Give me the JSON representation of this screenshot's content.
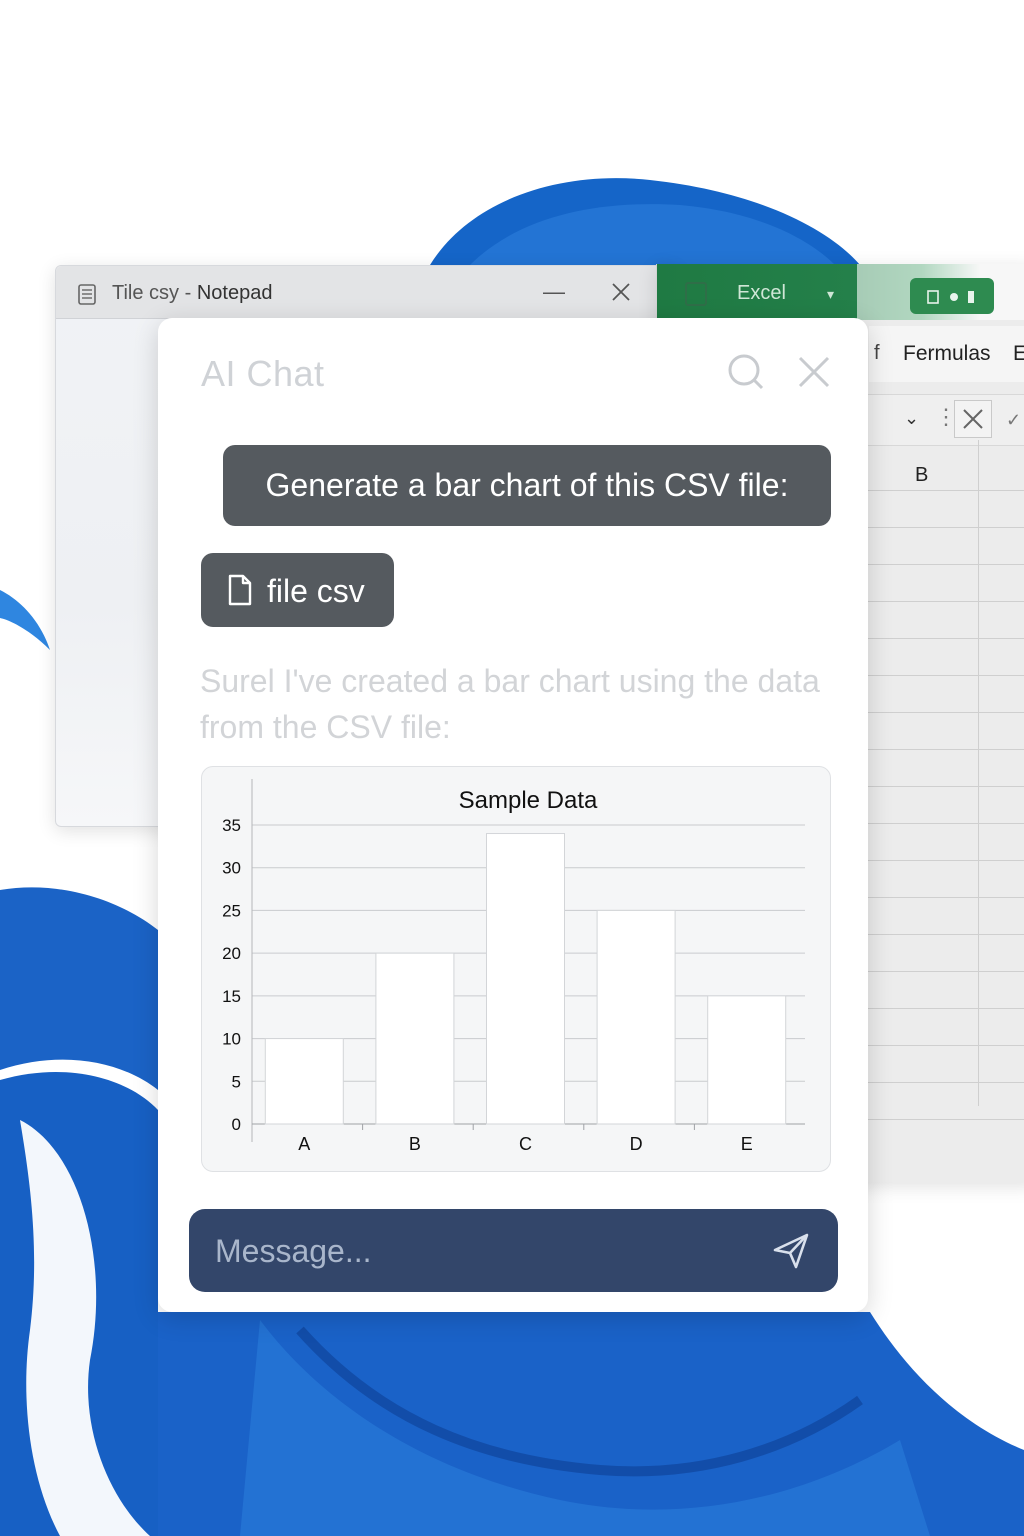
{
  "notepad": {
    "file_name": "Tile csy",
    "separator": " - ",
    "app_name": "Notepad",
    "minimize_glyph": "—"
  },
  "excel": {
    "title": "Excel",
    "caret": "▾",
    "tabs": {
      "mark": "f",
      "formulas": "Fermulas",
      "next": "E"
    },
    "dropdown": "⌄",
    "dots": "⋮",
    "check": "✓",
    "column_b": "B",
    "accent": "#1f7a43"
  },
  "chat": {
    "title": "AI Chat",
    "user_message": "Generate a bar chart of this CSV file:",
    "attachment_label": "file csv",
    "assistant_message": "Surel I've created a bar chart using the data from the CSV file:",
    "message_placeholder": "Message...",
    "bubble_color": "#555a5f",
    "input_color": "#33466a",
    "icons": {
      "search": "search-icon",
      "close": "close-icon",
      "file": "file-icon",
      "send": "send-icon"
    }
  },
  "chart_data": {
    "type": "bar",
    "title": "Sample Data",
    "xlabel": "",
    "ylabel": "",
    "categories": [
      "A",
      "B",
      "C",
      "D",
      "E"
    ],
    "values": [
      10,
      20,
      34,
      25,
      15
    ],
    "ylim": [
      0,
      35
    ],
    "yticks": [
      0,
      5,
      10,
      15,
      20,
      25,
      30,
      35
    ],
    "grid": true,
    "legend": false,
    "bar_color": "#ffffff"
  }
}
